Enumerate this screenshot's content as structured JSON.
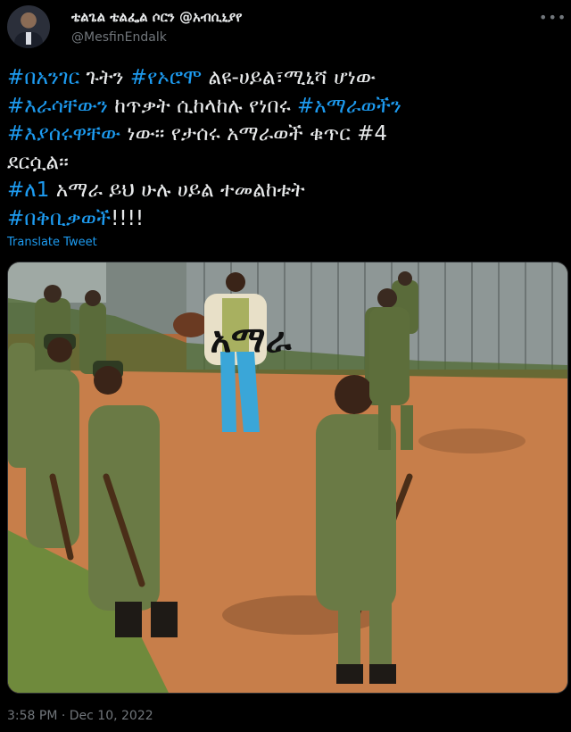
{
  "author": {
    "display_name": "ቴልጌል ቴልፌል ሶርን @አብሲኒያየ",
    "handle": "@MesfinEndalk"
  },
  "tweet": {
    "lines": [
      [
        {
          "t": "#በአንገር",
          "tag": true
        },
        {
          "t": " ጉትን ",
          "tag": false
        },
        {
          "t": "#የኦሮሞ",
          "tag": true
        },
        {
          "t": " ልዩ-ሀይል፣ሚኒሻ ሆነው",
          "tag": false
        }
      ],
      [
        {
          "t": "#እራሳቸውን",
          "tag": true
        },
        {
          "t": " ከጥቃት ሲከላከሉ የነበሩ ",
          "tag": false
        },
        {
          "t": "#አማራወችን",
          "tag": true
        }
      ],
      [
        {
          "t": "#እያሰሩዋቸው",
          "tag": true
        },
        {
          "t": " ነው። የታሰሩ አማራወች ቁጥር #4",
          "tag": false
        }
      ],
      [
        {
          "t": "ደርሷል።",
          "tag": false
        }
      ],
      [
        {
          "t": "#ለ1",
          "tag": true
        },
        {
          "t": " አማራ ይህ ሁሉ ሀይል ተመልከቱት",
          "tag": false
        }
      ],
      [
        {
          "t": "#በቅቢቃወች",
          "tag": true
        },
        {
          "t": "!!!!",
          "tag": false
        }
      ]
    ],
    "translate_label": "Translate Tweet",
    "media_overlay_text": "አማራ",
    "timestamp": "3:58 PM · Dec 10, 2022"
  },
  "colors": {
    "background": "#000000",
    "text": "#e7e9ea",
    "hashtag": "#1d9bf0",
    "secondary": "#71767b"
  },
  "icons": {
    "more": "more-horizontal-icon"
  }
}
